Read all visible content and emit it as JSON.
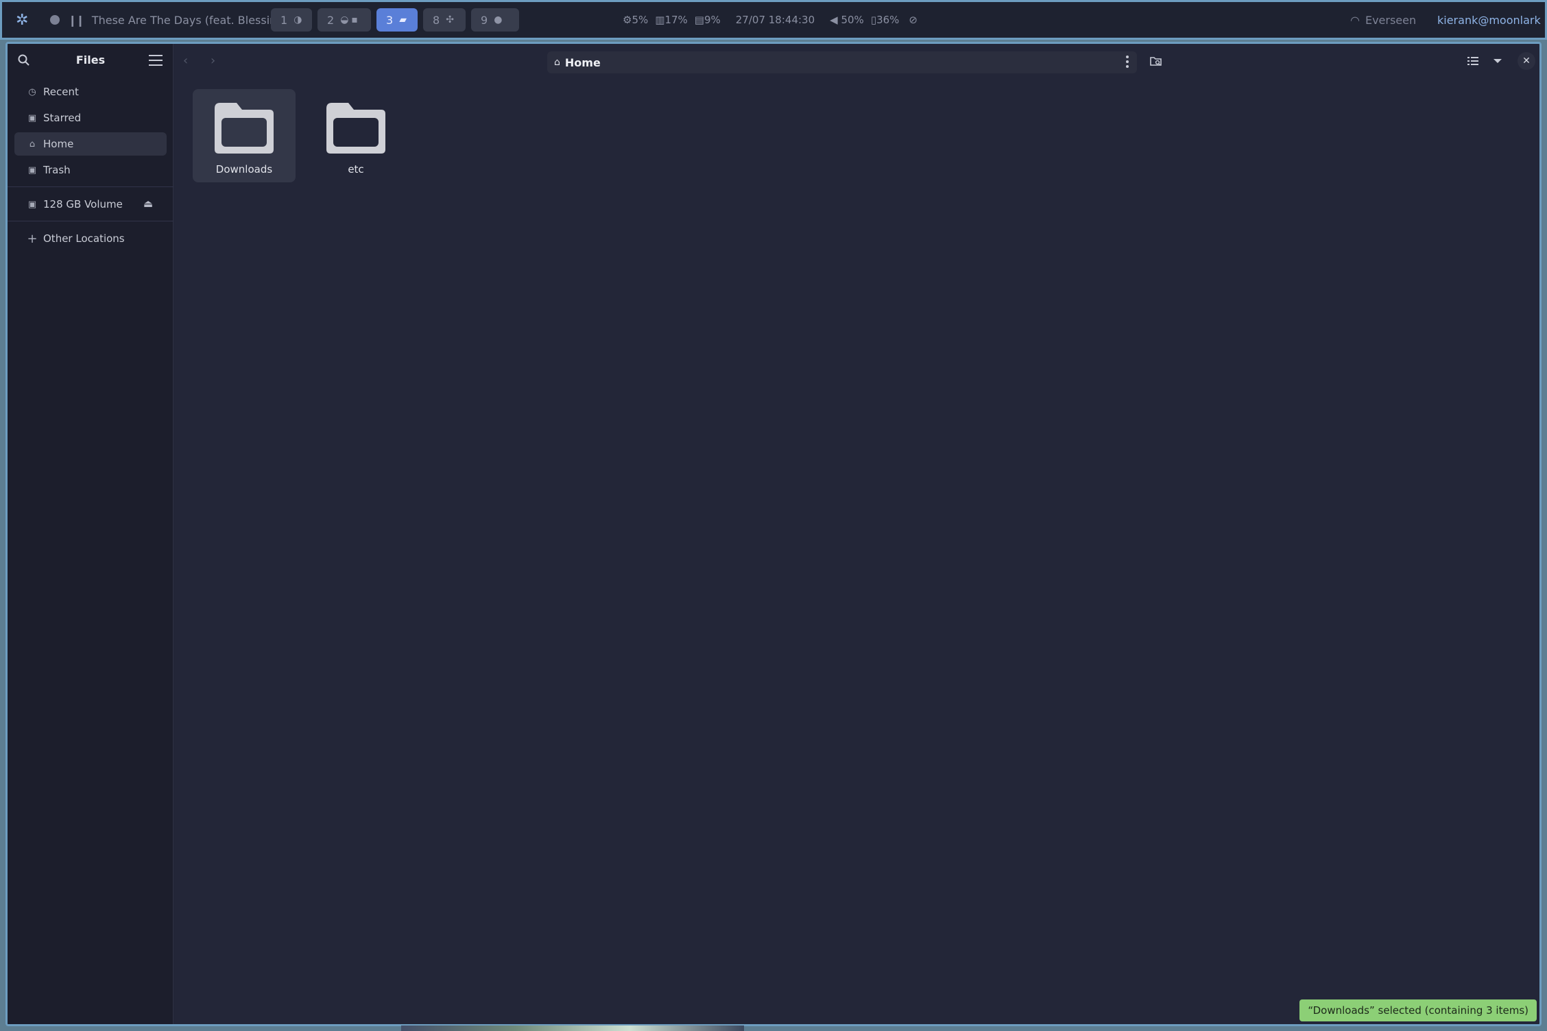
{
  "topbar": {
    "media_title": "These Are The Days (feat. Blessin...",
    "workspaces": [
      {
        "num": "1",
        "active": false
      },
      {
        "num": "2",
        "active": false
      },
      {
        "num": "3",
        "active": true
      },
      {
        "num": "8",
        "active": false
      },
      {
        "num": "9",
        "active": false
      }
    ],
    "cpu": "5%",
    "memory": "17%",
    "disk": "9%",
    "datetime": "27/07 18:44:30",
    "volume": "50%",
    "battery": "36%",
    "wifi_name": "Everseen",
    "user": "kierank@moonlark",
    "accent_color": "#5a7fd8"
  },
  "sidebar": {
    "title": "Files",
    "places": [
      {
        "label": "Recent",
        "icon": "clock-icon"
      },
      {
        "label": "Starred",
        "icon": "star-icon"
      },
      {
        "label": "Home",
        "icon": "home-icon",
        "selected": true
      },
      {
        "label": "Trash",
        "icon": "trash-icon"
      }
    ],
    "devices": [
      {
        "label": "128 GB Volume",
        "icon": "drive-icon"
      }
    ],
    "other_locations": "Other Locations"
  },
  "path": {
    "current": "Home"
  },
  "files": [
    {
      "name": "Downloads",
      "type": "folder",
      "selected": true
    },
    {
      "name": "etc",
      "type": "folder",
      "selected": false
    }
  ],
  "status_toast": "“Downloads” selected (containing 3 items)"
}
